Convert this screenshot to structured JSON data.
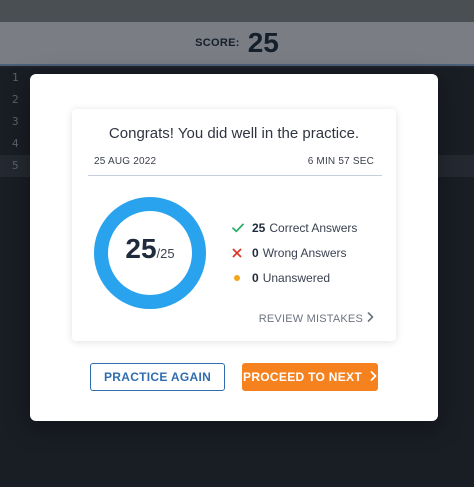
{
  "header": {
    "score_label": "SCORE:",
    "score_value": "25"
  },
  "editor": {
    "line_numbers": [
      "1",
      "2",
      "3",
      "4",
      "5"
    ]
  },
  "result": {
    "title": "Congrats! You did well in the practice.",
    "date": "25 AUG 2022",
    "duration": "6 MIN 57 SEC",
    "score": "25",
    "total": "/25",
    "score_fraction": 1.0,
    "stats": [
      {
        "count": "25",
        "label": "Correct Answers",
        "icon": "check-icon"
      },
      {
        "count": "0",
        "label": "Wrong Answers",
        "icon": "cross-icon"
      },
      {
        "count": "0",
        "label": "Unanswered",
        "icon": "dot-icon"
      }
    ],
    "review_label": "REVIEW MISTAKES"
  },
  "actions": {
    "practice_again": "PRACTICE AGAIN",
    "proceed_next": "PROCEED TO NEXT"
  },
  "colors": {
    "ring": "#29a3ee",
    "accent_orange": "#f5821f",
    "outline_blue": "#2f6db0",
    "check": "#2fae6b",
    "cross": "#d93a2b",
    "dot": "#f2a61c"
  }
}
